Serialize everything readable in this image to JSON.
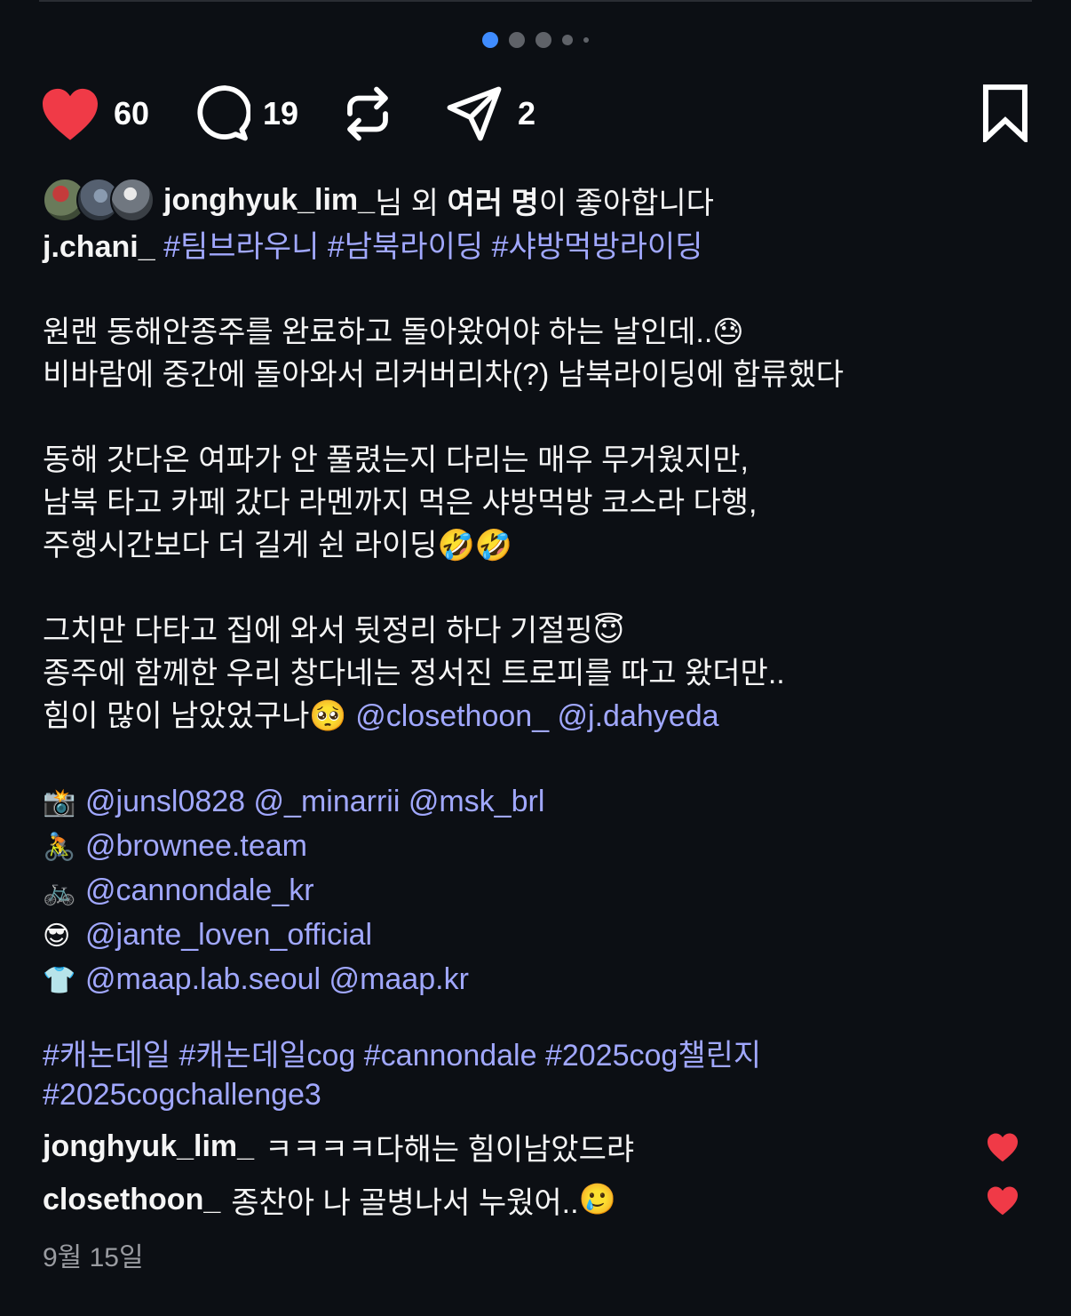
{
  "carousel": {
    "count": 5,
    "active_index": 0
  },
  "actions": {
    "likes": "60",
    "comments": "19",
    "shares": "2"
  },
  "liked_by": {
    "user": "jonghyuk_lim_",
    "mid": "님 외 ",
    "bold": "여러 명",
    "suffix": "이 좋아합니다"
  },
  "post": {
    "author": "j.chani_",
    "header_tags": "#팀브라우니 #남북라이딩 #샤방먹방라이딩",
    "lines": [
      {
        "text": "원랜 동해안종주를 완료하고 돌아왔어야 하는 날인데..",
        "emoji": "😓"
      },
      {
        "text": "비바람에 중간에 돌아와서 리커버리차(?) 남북라이딩에 합류했다",
        "emoji": ""
      },
      {
        "text": "동해 갓다온 여파가 안 풀렸는지 다리는 매우 무거웠지만,",
        "emoji": ""
      },
      {
        "text": "남북 타고 카페 갔다 라멘까지 먹은 샤방먹방 코스라 다행,",
        "emoji": ""
      },
      {
        "text": "주행시간보다 더 길게 쉰 라이딩",
        "emoji": "🤣🤣"
      },
      {
        "text": "그치만 다타고 집에 와서 뒷정리 하다 기절핑",
        "emoji": "😇"
      },
      {
        "text": "종주에 함께한 우리 창다네는 정서진 트로피를 따고 왔더만..",
        "emoji": ""
      },
      {
        "text": "힘이 많이 남았었구나",
        "emoji": "🥺",
        "mentions": "@closethoon_ @j.dahyeda"
      }
    ],
    "credits": [
      {
        "icon": "camera-flash-icon",
        "glyph": "📸",
        "mentions": "@junsl0828 @_minarrii @msk_brl"
      },
      {
        "icon": "cyclist-icon",
        "glyph": "🚴",
        "mentions": "@brownee.team"
      },
      {
        "icon": "bicycle-icon",
        "glyph": "🚲",
        "mentions": "@cannondale_kr"
      },
      {
        "icon": "sunglasses-face-icon",
        "glyph": "😎",
        "mentions": "@jante_loven_official"
      },
      {
        "icon": "shirt-icon",
        "glyph": "👕",
        "mentions": "@maap.lab.seoul @maap.kr"
      }
    ],
    "footer_tags_1": "#캐논데일 #캐논데일cog #cannondale #2025cog챌린지",
    "footer_tags_2": "#2025cogchallenge3"
  },
  "comments": [
    {
      "user": "jonghyuk_lim_",
      "text": "ㅋㅋㅋㅋ다해는 힘이남았드랴",
      "emoji": ""
    },
    {
      "user": "closethoon_",
      "text": "종찬아 나 골병나서 누웠어..",
      "emoji": "🥲"
    }
  ],
  "date": "9월 15일",
  "colors": {
    "like": "#f03a47",
    "link": "#a1a8ff",
    "active_dot": "#3f8cff",
    "background": "#0c0f14"
  }
}
